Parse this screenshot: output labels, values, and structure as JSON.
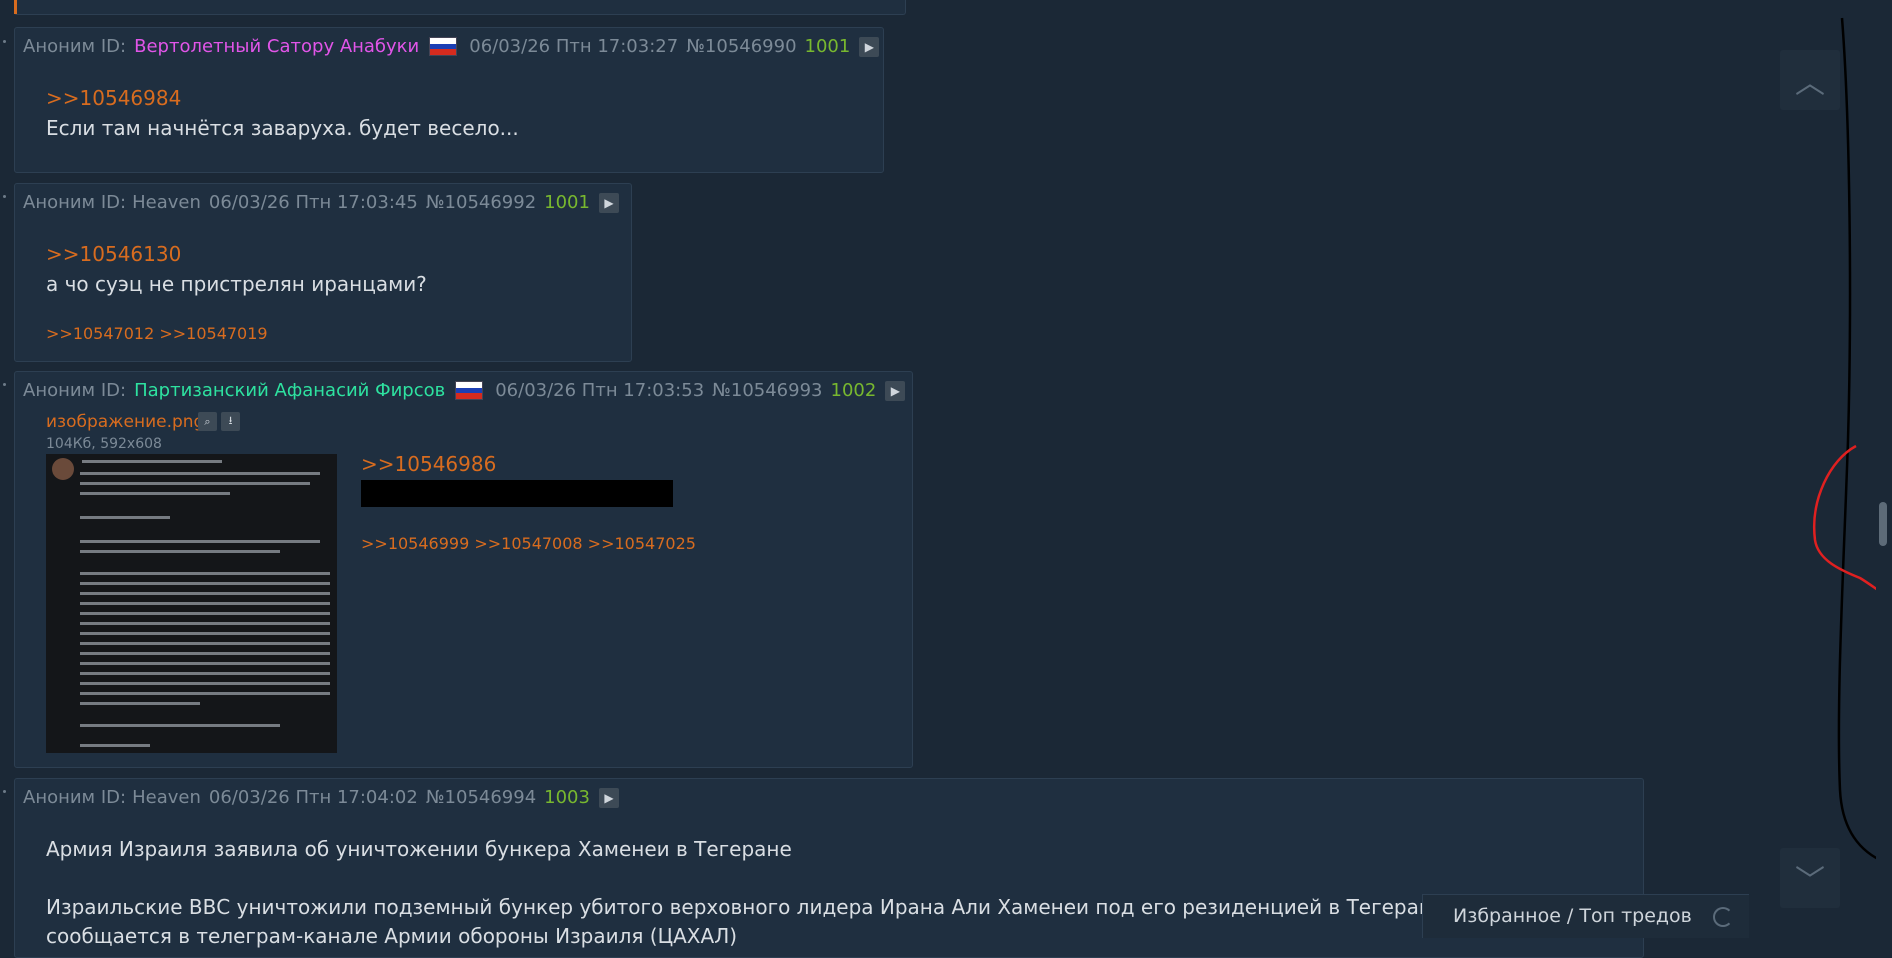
{
  "posts": [
    {
      "anon": "Аноним ID:",
      "uid": "Вертолетный Сатору Анабуки",
      "date": "06/03/26 Птн 17:03:27",
      "num": "№10546990",
      "count": "1001",
      "reply": ">>10546984",
      "text": "Если там начнётся заваруха. будет весело..."
    },
    {
      "anon": "Аноним ID:",
      "uid": "Heaven",
      "date": "06/03/26 Птн 17:03:45",
      "num": "№10546992",
      "count": "1001",
      "reply": ">>10546130",
      "text": "а чо суэц не пристрелян иранцами?",
      "backlinks": ">>10547012 >>10547019"
    },
    {
      "anon": "Аноним ID:",
      "uid": "Партизанский Афанасий Фирсов",
      "date": "06/03/26 Птн 17:03:53",
      "num": "№10546993",
      "count": "1002",
      "file_name": "изображение.png",
      "file_meta": "104Кб, 592x608",
      "reply": ">>10546986",
      "backlinks": ">>10546999 >>10547008 >>10547025"
    },
    {
      "anon": "Аноним ID:",
      "uid": "Heaven",
      "date": "06/03/26 Птн 17:04:02",
      "num": "№10546994",
      "count": "1003",
      "text1": "Армия Израиля заявила об уничтожении бункера Хаменеи в Тегеране",
      "text2": "Израильские ВВС уничтожили подземный бункер убитого верховного лидера Ирана Али Хаменеи под его резиденцией в Тегеране.",
      "text3": "сообщается в телеграм-канале Армии обороны Израиля (ЦАХАЛ)"
    }
  ],
  "bottom_bar": {
    "label": "Избранное / Топ тредов"
  },
  "icons": {
    "play": "play-icon",
    "search": "search-icon",
    "download": "download-icon",
    "up": "chevron-up-icon",
    "down": "chevron-down-icon",
    "refresh": "refresh-icon"
  },
  "colors": {
    "background": "#1b2836",
    "post_bg": "#1f2f40",
    "link": "#d86c1f",
    "count": "#78b82f",
    "uid_pink": "#e155e8",
    "uid_green": "#2ee2a0"
  }
}
